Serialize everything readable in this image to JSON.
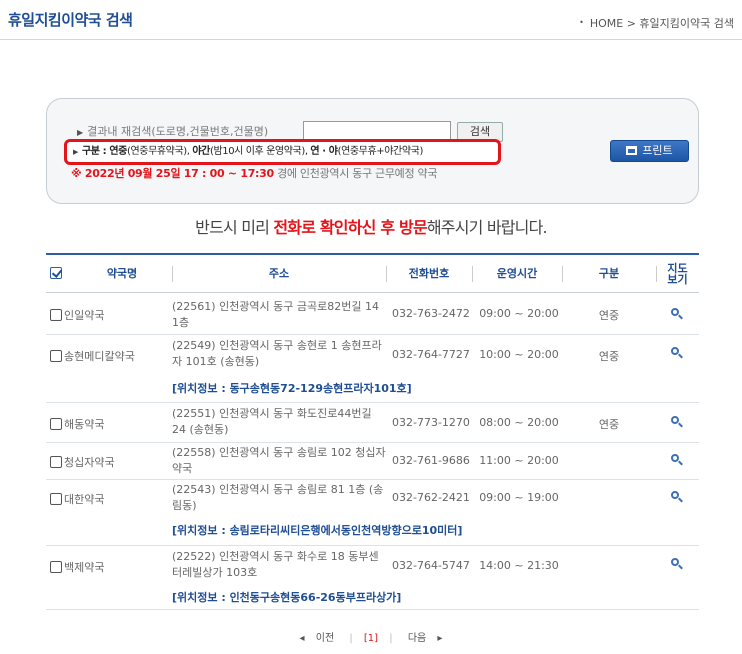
{
  "header": {
    "title": "휴일지킴이약국 검색",
    "breadcrumb_home": "HOME",
    "breadcrumb_sep": ">",
    "breadcrumb_current": "휴일지킴이약국 검색"
  },
  "search": {
    "label": "결과내 재검색(도로명,건물번호,건물명)",
    "value": "",
    "button": "검색",
    "print_button": "프린트",
    "legend_prefix": "구분 : ",
    "legend_a_key": "연중",
    "legend_a_desc": "(연중무휴약국), ",
    "legend_b_key": "야간",
    "legend_b_desc": "(밤10시 이후 운영약국), ",
    "legend_c_key": "연 · 야",
    "legend_c_desc": "(연중무휴+야간약국)",
    "notice_red": "※ 2022년 09월 25일 17 : 00 ~ 17:30",
    "notice_rest": " 경에 인천광역시 동구 근무예정 약국"
  },
  "advice": {
    "part1": "반드시 미리 ",
    "part2": "전화로 확인하신 후 방문",
    "part3": "해주시기 바랍니다."
  },
  "table": {
    "headers": {
      "name": "약국명",
      "address": "주소",
      "phone": "전화번호",
      "hours": "운영시간",
      "type": "구분",
      "map_line1": "지도",
      "map_line2": "보기"
    },
    "rows": [
      {
        "name": "인일약국",
        "address": "(22561) 인천광역시 동구 금곡로82번길 14 1층",
        "phone": "032-763-2472",
        "hours": "09:00 ~ 20:00",
        "type": "연중",
        "location": ""
      },
      {
        "name": "송현메디칼약국",
        "address": "(22549) 인천광역시 동구 송현로 1 송현프라자 101호 (송현동)",
        "phone": "032-764-7727",
        "hours": "10:00 ~ 20:00",
        "type": "연중",
        "location": "[위치정보 : 동구송현동72-129송현프라자101호]"
      },
      {
        "name": "해동약국",
        "address": "(22551) 인천광역시 동구 화도진로44번길 24 (송현동)",
        "phone": "032-773-1270",
        "hours": "08:00 ~ 20:00",
        "type": "연중",
        "location": ""
      },
      {
        "name": "청십자약국",
        "address": "(22558) 인천광역시 동구 송림로 102 청십자약국",
        "phone": "032-761-9686",
        "hours": "11:00 ~ 20:00",
        "type": "",
        "location": ""
      },
      {
        "name": "대한약국",
        "address": "(22543) 인천광역시 동구 송림로 81 1층 (송림동)",
        "phone": "032-762-2421",
        "hours": "09:00 ~ 19:00",
        "type": "",
        "location": "[위치정보 : 송림로타리씨티은행에서동인천역방향으로10미터]"
      },
      {
        "name": "백제약국",
        "address": "(22522) 인천광역시 동구 화수로 18 동부센터레빌상가 103호",
        "phone": "032-764-5747",
        "hours": "14:00 ~ 21:30",
        "type": "",
        "location": "[위치정보 : 인천동구송현동66-26동부프라상가]"
      }
    ]
  },
  "pager": {
    "prev": "이전",
    "current": "[1]",
    "next": "다음"
  },
  "colors": {
    "brand": "#1f4e93",
    "highlight": "#e3141a"
  }
}
